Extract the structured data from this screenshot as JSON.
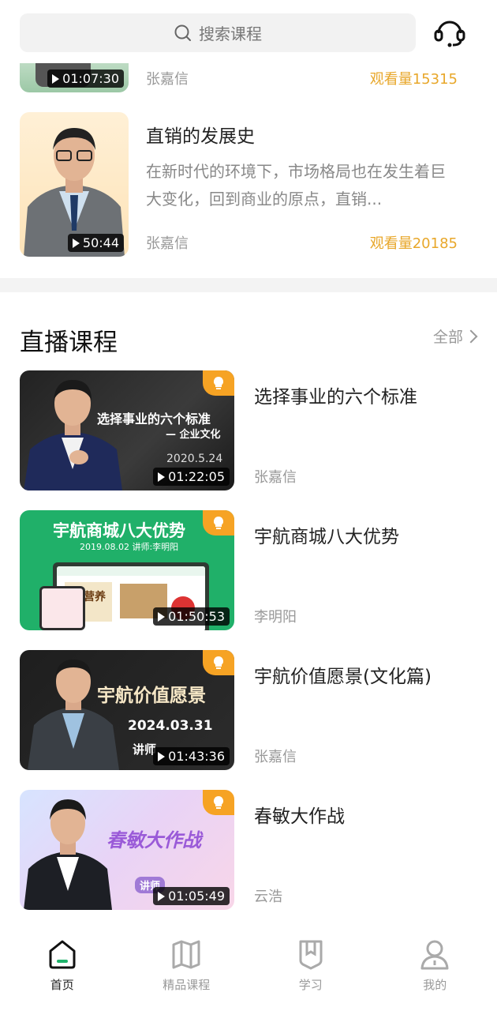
{
  "header": {
    "search_placeholder": "搜索课程",
    "support_icon": "headset-icon"
  },
  "recorded": [
    {
      "duration": "01:07:30",
      "author": "张嘉信",
      "views": "观看量15315"
    },
    {
      "title": "直销的发展史",
      "desc": "在新时代的环境下，市场格局也在发生着巨大变化，回到商业的原点，直销...",
      "duration": "50:44",
      "author": "张嘉信",
      "views": "观看量20185"
    }
  ],
  "live_section": {
    "title": "直播课程",
    "all_label": "全部",
    "items": [
      {
        "title": "选择事业的六个标准",
        "author": "张嘉信",
        "duration": "01:22:05",
        "poster_line1": "选择事业的六个标准",
        "poster_line2": "— 企业文化",
        "poster_date": "2020.5.24"
      },
      {
        "title": "宇航商城八大优势",
        "author": "李明阳",
        "duration": "01:50:53",
        "poster_line1": "宇航商城八大优势",
        "poster_line2": "2019.08.02  讲师:李明阳",
        "poster_badge": "营养"
      },
      {
        "title": "宇航价值愿景(文化篇)",
        "author": "张嘉信",
        "duration": "01:43:36",
        "poster_line1": "宇航价值愿景",
        "poster_date": "2024.03.31",
        "poster_line3": "讲师"
      },
      {
        "title": "春敏大作战",
        "author": "云浩",
        "duration": "01:05:49",
        "poster_line1": "春敏大作战",
        "poster_line3": "讲师"
      }
    ]
  },
  "tabbar": {
    "items": [
      {
        "label": "首页",
        "icon": "home-icon",
        "active": true
      },
      {
        "label": "精品课程",
        "icon": "book-icon",
        "active": false
      },
      {
        "label": "学习",
        "icon": "bookmark-icon",
        "active": false
      },
      {
        "label": "我的",
        "icon": "user-icon",
        "active": false
      }
    ]
  },
  "colors": {
    "accent_green": "#1fb36b",
    "views_orange": "#e8a72a",
    "bulb_orange": "#f6a324"
  }
}
